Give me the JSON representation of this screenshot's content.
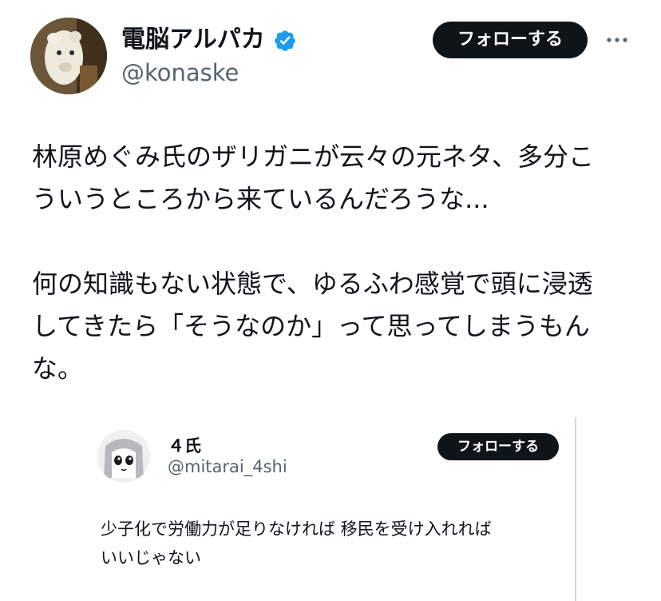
{
  "tweet": {
    "author": {
      "display_name": "電脳アルパカ",
      "handle": "@konaske",
      "avatar_icon": "alpaca-avatar",
      "verified_icon": "verified-badge-icon",
      "verified_color": "#1d9bf0"
    },
    "follow_label": "フォローする",
    "more_icon": "more-dots-icon",
    "text": "林原めぐみ氏のザリガニが云々の元ネタ、多分こ\nういうところから来ているんだろうな...\n\n何の知識もない状態で、ゆるふわ感覚で頭に浸透\nしてきたら「そうなのか」って思ってしまうもん\nな。"
  },
  "quote": {
    "author": {
      "display_name": "４氏",
      "handle": "@mitarai_4shi",
      "avatar_icon": "cartoon-character-avatar"
    },
    "follow_label": "フォローする",
    "text": "少子化で労働力が足りなければ 移民を受け入れれば\nいいじゃない"
  },
  "colors": {
    "text": "#0f1419",
    "secondary_text": "#536471",
    "button_bg": "#0f1419",
    "button_text": "#ffffff",
    "border": "#cfd9de"
  }
}
